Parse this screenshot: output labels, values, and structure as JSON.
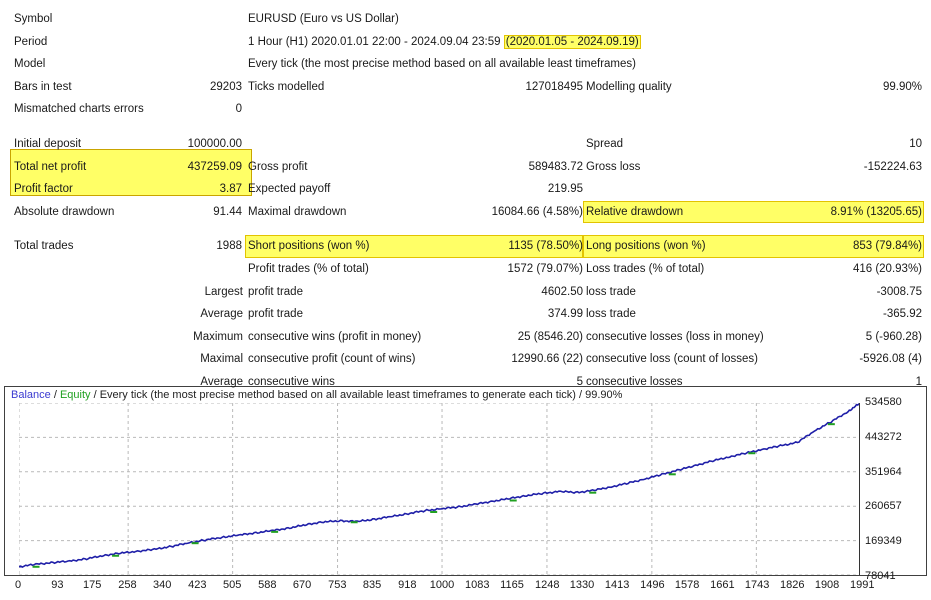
{
  "report": {
    "rows": [
      {
        "label1": "Symbol",
        "value1": "",
        "label2": "EURUSD (Euro vs US Dollar)",
        "wide": true
      },
      {
        "label1": "Period",
        "value1": "",
        "label2": "1 Hour (H1) 2020.01.01 22:00 - 2024.09.04 23:59 ",
        "label2_hl": "(2020.01.05 - 2024.09.19)",
        "wide": true
      },
      {
        "label1": "Model",
        "value1": "",
        "label2": "Every tick (the most precise method based on all available least timeframes)",
        "wide": true
      },
      {
        "label1": "Bars in test",
        "value1": "29203",
        "label2": "Ticks modelled",
        "value2": "127018495",
        "label3": "Modelling quality",
        "value3": "99.90%"
      },
      {
        "label1": "Mismatched charts errors",
        "value1": "0"
      },
      {
        "spacer": true
      },
      {
        "label1": "Initial deposit",
        "value1": "100000.00",
        "label3": "Spread",
        "value3": "10"
      },
      {
        "label1": "Total net profit",
        "value1": "437259.09",
        "label2": "Gross profit",
        "value2": "589483.72",
        "label3": "Gross loss",
        "value3": "-152224.63"
      },
      {
        "label1": "Profit factor",
        "value1": "3.87",
        "label2": "Expected payoff",
        "value2": "219.95"
      },
      {
        "label1": "Absolute drawdown",
        "value1": "91.44",
        "label2": "Maximal drawdown",
        "value2": "16084.66 (4.58%)",
        "label3": "Relative drawdown",
        "value3": "8.91% (13205.65)"
      },
      {
        "spacer": true
      },
      {
        "label1": "Total trades",
        "value1": "1988",
        "label2": "Short positions (won %)",
        "value2": "1135 (78.50%)",
        "label3": "Long positions (won %)",
        "value3": "853 (79.84%)"
      },
      {
        "label2": "Profit trades (% of total)",
        "value2": "1572 (79.07%)",
        "label3": "Loss trades (% of total)",
        "value3": "416 (20.93%)"
      },
      {
        "labelR": "Largest",
        "label2": "profit trade",
        "value2": "4602.50",
        "label3": "loss trade",
        "value3": "-3008.75"
      },
      {
        "labelR": "Average",
        "label2": "profit trade",
        "value2": "374.99",
        "label3": "loss trade",
        "value3": "-365.92"
      },
      {
        "labelR": "Maximum",
        "label2": "consecutive wins (profit in money)",
        "value2": "25 (8546.20)",
        "label3": "consecutive losses (loss in money)",
        "value3": "5 (-960.28)"
      },
      {
        "labelR": "Maximal",
        "label2": "consecutive profit (count of wins)",
        "value2": "12990.66 (22)",
        "label3": "consecutive loss (count of losses)",
        "value3": "-5926.08 (4)"
      },
      {
        "labelR": "Average",
        "label2": "consecutive wins",
        "value2": "5",
        "label3": "consecutive losses",
        "value3": "1"
      }
    ]
  },
  "highlight_color": "#ffff66",
  "chart_data": {
    "type": "line",
    "title": "",
    "legend": {
      "balance_label": "Balance",
      "equity_label": "Equity",
      "separator": " / ",
      "description": "Every tick (the most precise method based on all available least timeframes to generate each tick) / 99.90%"
    },
    "xlabel": "",
    "ylabel": "",
    "xlim": [
      0,
      1988
    ],
    "ylim": [
      78041,
      534580
    ],
    "grid": true,
    "legend_position": "top-left",
    "xticks": [
      0,
      93,
      175,
      258,
      340,
      423,
      505,
      588,
      670,
      753,
      835,
      918,
      1000,
      1083,
      1165,
      1248,
      1330,
      1413,
      1496,
      1578,
      1661,
      1743,
      1826,
      1908,
      1991
    ],
    "yticks": [
      534580,
      443272,
      351964,
      260657,
      169349,
      78041
    ],
    "series": [
      {
        "name": "Balance",
        "color": "#1f1fa8",
        "x": [
          0,
          40,
          80,
          120,
          160,
          200,
          240,
          280,
          320,
          360,
          400,
          440,
          480,
          520,
          560,
          600,
          640,
          680,
          720,
          760,
          800,
          840,
          880,
          920,
          960,
          1000,
          1040,
          1080,
          1120,
          1160,
          1200,
          1240,
          1280,
          1320,
          1360,
          1400,
          1440,
          1480,
          1520,
          1560,
          1600,
          1640,
          1680,
          1720,
          1760,
          1800,
          1840,
          1880,
          1920,
          1960,
          1988
        ],
        "y": [
          100000,
          106500,
          111000,
          115000,
          121000,
          130000,
          136000,
          141000,
          146000,
          154000,
          163000,
          171000,
          178000,
          184000,
          190000,
          196000,
          203000,
          212000,
          219000,
          222000,
          220000,
          226000,
          233000,
          241000,
          249000,
          254000,
          259000,
          266000,
          274000,
          281000,
          289000,
          295000,
          300000,
          297000,
          303000,
          312000,
          322000,
          333000,
          345000,
          357000,
          369000,
          381000,
          392000,
          402000,
          412000,
          421000,
          430000,
          460000,
          485000,
          512000,
          534580
        ]
      },
      {
        "name": "Equity",
        "color": "#21a021",
        "x": [],
        "y": []
      }
    ]
  }
}
